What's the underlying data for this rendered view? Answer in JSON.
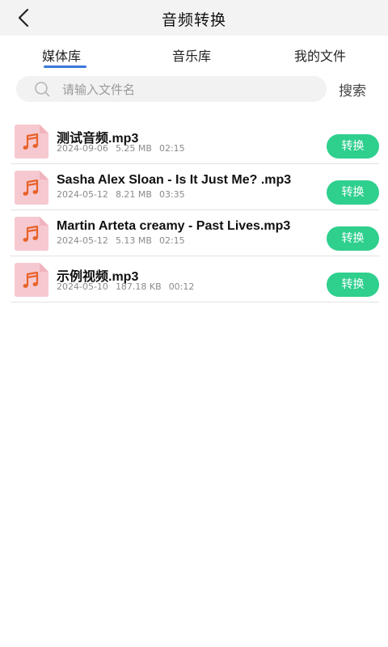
{
  "header": {
    "title": "音频转换"
  },
  "tabs": [
    {
      "label": "媒体库",
      "active": true
    },
    {
      "label": "音乐库",
      "active": false
    },
    {
      "label": "我的文件",
      "active": false
    }
  ],
  "search": {
    "placeholder": "请输入文件名",
    "button_label": "搜索"
  },
  "files": [
    {
      "name": "测试音频.mp3",
      "date": "2024-09-06",
      "size": "5.25 MB",
      "duration": "02:15",
      "action": "转换"
    },
    {
      "name": "Sasha Alex Sloan - Is It Just Me?  .mp3",
      "date": "2024-05-12",
      "size": "8.21 MB",
      "duration": "03:35",
      "action": "转换"
    },
    {
      "name": "Martin Arteta creamy - Past Lives.mp3",
      "date": "2024-05-12",
      "size": "5.13 MB",
      "duration": "02:15",
      "action": "转换"
    },
    {
      "name": "示例视频.mp3",
      "date": "2024-05-10",
      "size": "187.18 KB",
      "duration": "00:12",
      "action": "转换"
    }
  ],
  "colors": {
    "accent": "#3a78d8",
    "button": "#2fcf8e",
    "thumb_bg": "#f6c9d0",
    "note_icon": "#e8622a"
  },
  "icons": {
    "back": "chevron-left-icon",
    "search": "search-icon",
    "file": "music-note-icon"
  }
}
